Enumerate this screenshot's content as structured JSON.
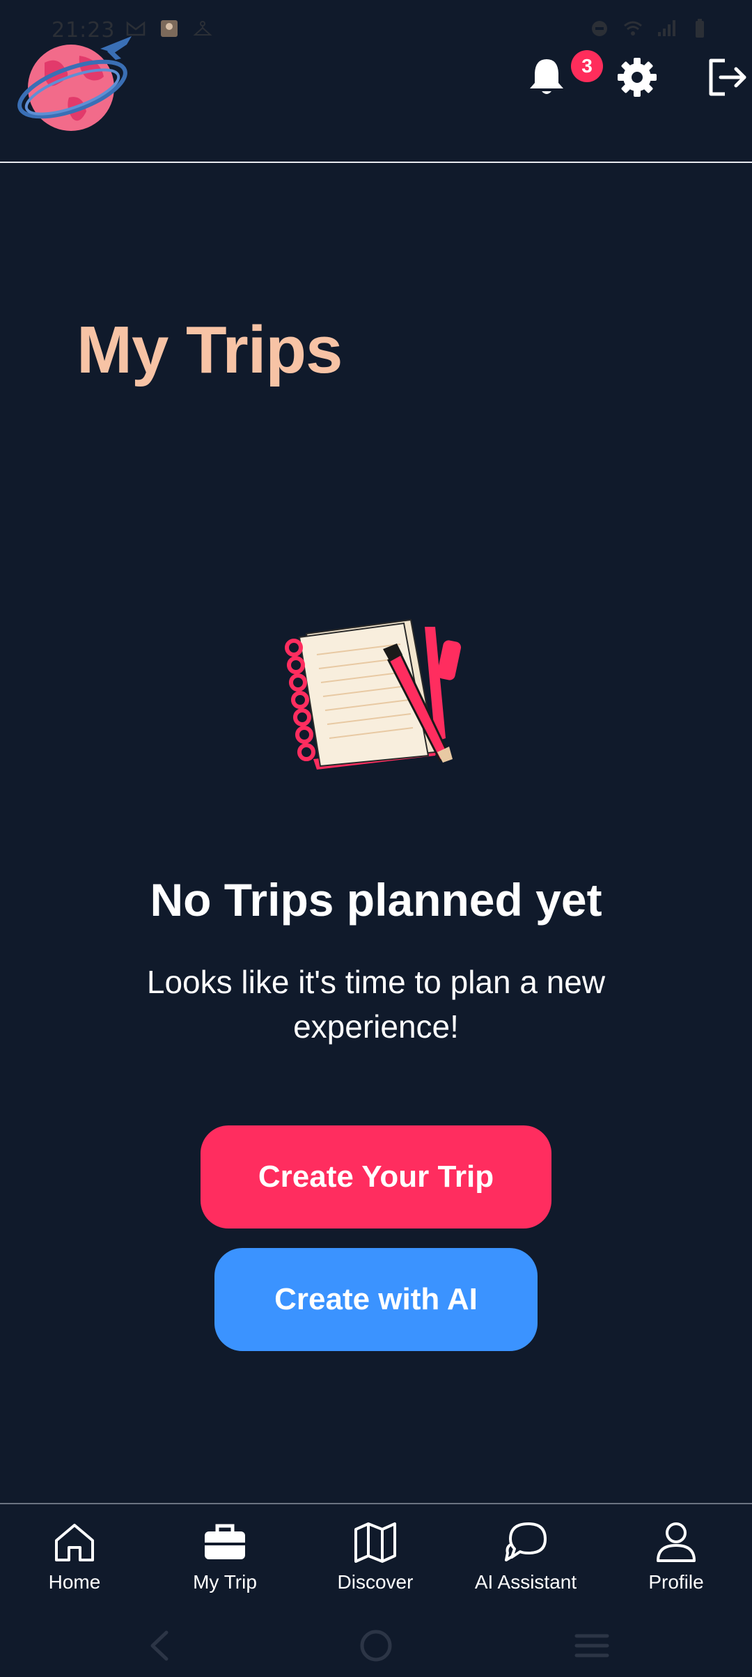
{
  "status_bar": {
    "time": "21:23",
    "icons": [
      "gmail-icon",
      "photo-thumbnail-icon",
      "hanger-icon",
      "dnd-icon",
      "wifi-icon",
      "signal-icon",
      "battery-icon"
    ]
  },
  "header": {
    "logo": "globe-airplane-logo",
    "notifications_count": "3",
    "actions": [
      "bell-icon",
      "gear-icon",
      "logout-icon"
    ]
  },
  "main": {
    "title": "My Trips",
    "empty_state": {
      "illustration": "notebook-pen-illustration",
      "heading": "No Trips planned yet",
      "message": "Looks like it's time to plan a new experience!"
    },
    "buttons": {
      "create_trip": "Create Your Trip",
      "create_ai": "Create with AI"
    }
  },
  "bottom_nav": {
    "items": [
      {
        "label": "Home",
        "icon": "home-icon"
      },
      {
        "label": "My Trip",
        "icon": "briefcase-icon"
      },
      {
        "label": "Discover",
        "icon": "map-icon"
      },
      {
        "label": "AI Assistant",
        "icon": "chat-icon"
      },
      {
        "label": "Profile",
        "icon": "person-icon"
      }
    ]
  },
  "colors": {
    "background": "#101a2b",
    "title": "#f7c3a5",
    "primary_button": "#ff2d5f",
    "ai_button": "#3b93ff",
    "badge": "#ff2d5b"
  }
}
